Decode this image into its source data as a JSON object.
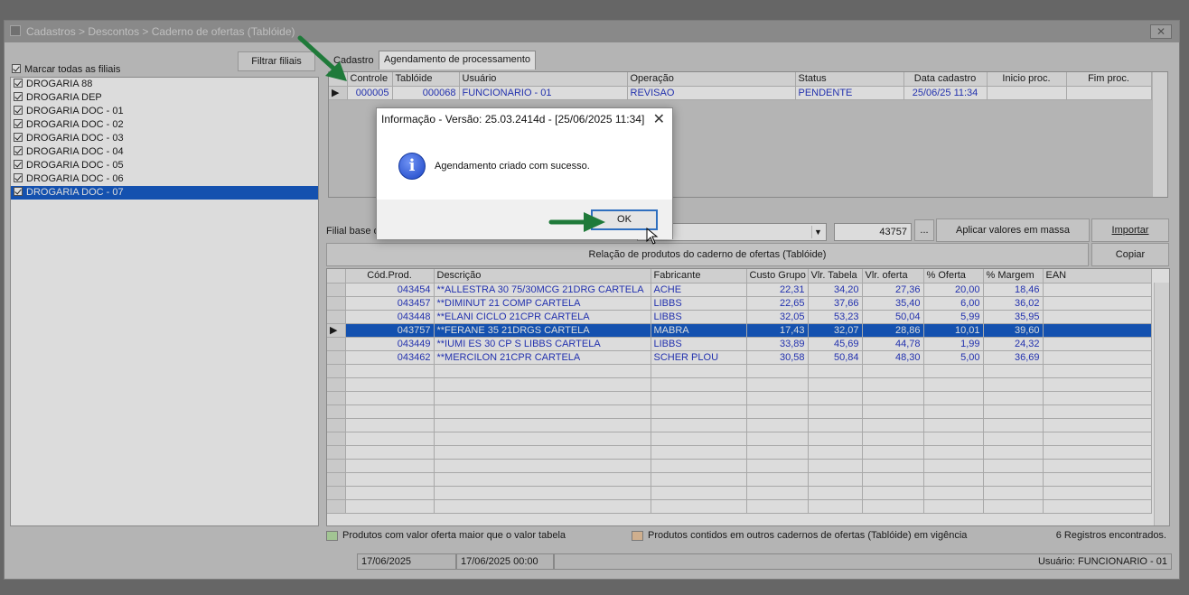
{
  "window": {
    "title": "Cadastros > Descontos > Caderno de ofertas (Tablóide)",
    "close_glyph": "✕"
  },
  "left_panel": {
    "filter_button": "Filtrar filiais",
    "select_all_label": "Marcar todas as filiais",
    "branches": [
      "DROGARIA 88",
      "DROGARIA DEP",
      "DROGARIA DOC - 01",
      "DROGARIA DOC - 02",
      "DROGARIA DOC - 03",
      "DROGARIA DOC - 04",
      "DROGARIA DOC - 05",
      "DROGARIA DOC - 06",
      "DROGARIA DOC - 07"
    ]
  },
  "tabs": {
    "tab1": "Cadastro",
    "tab2": "Agendamento de processamento"
  },
  "schedule_grid": {
    "headers": {
      "controle": "Controle",
      "tabloide": "Tablóide",
      "usuario": "Usuário",
      "operacao": "Operação",
      "status": "Status",
      "data_cadastro": "Data cadastro",
      "inicio": "Inicio proc.",
      "fim": "Fim proc."
    },
    "row": {
      "controle": "000005",
      "tabloide": "000068",
      "usuario": "FUNCIONARIO - 01",
      "operacao": "REVISAO",
      "status": "PENDENTE",
      "data_cadastro": "25/06/25 11:34",
      "inicio": "",
      "fim": ""
    }
  },
  "filial_label": "Filial base de",
  "product_code_value": "43757",
  "ellipsis_button": "...",
  "mass_button": "Aplicar valores em massa",
  "import_button": "Importar",
  "products_title": "Relação de produtos do caderno de ofertas (Tablóide)",
  "copy_button": "Copiar",
  "products_grid": {
    "headers": {
      "cod": "Cód.Prod.",
      "desc": "Descrição",
      "fab": "Fabricante",
      "custo": "Custo Grupo",
      "vtab": "Vlr. Tabela",
      "voferta": "Vlr. oferta",
      "pof": "% Oferta",
      "pmar": "% Margem",
      "ean": "EAN"
    },
    "rows": [
      {
        "cod": "043454",
        "desc": "**ALLESTRA 30 75/30MCG 21DRG CARTELA",
        "fab": "ACHE",
        "custo": "22,31",
        "vtab": "34,20",
        "voferta": "27,36",
        "pof": "20,00",
        "pmar": "18,46",
        "ean": ""
      },
      {
        "cod": "043457",
        "desc": "**DIMINUT 21 COMP CARTELA",
        "fab": "LIBBS",
        "custo": "22,65",
        "vtab": "37,66",
        "voferta": "35,40",
        "pof": "6,00",
        "pmar": "36,02",
        "ean": ""
      },
      {
        "cod": "043448",
        "desc": "**ELANI CICLO 21CPR CARTELA",
        "fab": "LIBBS",
        "custo": "32,05",
        "vtab": "53,23",
        "voferta": "50,04",
        "pof": "5,99",
        "pmar": "35,95",
        "ean": ""
      },
      {
        "cod": "043757",
        "desc": "**FERANE 35 21DRGS CARTELA",
        "fab": "MABRA",
        "custo": "17,43",
        "vtab": "32,07",
        "voferta": "28,86",
        "pof": "10,01",
        "pmar": "39,60",
        "ean": ""
      },
      {
        "cod": "043449",
        "desc": "**IUMI ES 30 CP S LIBBS CARTELA",
        "fab": "LIBBS",
        "custo": "33,89",
        "vtab": "45,69",
        "voferta": "44,78",
        "pof": "1,99",
        "pmar": "24,32",
        "ean": ""
      },
      {
        "cod": "043462",
        "desc": "**MERCILON 21CPR CARTELA",
        "fab": "SCHER PLOU",
        "custo": "30,58",
        "vtab": "50,84",
        "voferta": "48,30",
        "pof": "5,00",
        "pmar": "36,69",
        "ean": ""
      }
    ]
  },
  "legend": {
    "green": "Produtos com valor oferta maior que o valor tabela",
    "orange": "Produtos contidos em outros cadernos de ofertas (Tablóide) em vigência",
    "count": "6 Registros encontrados."
  },
  "status_bar": {
    "date1": "17/06/2025",
    "date2": "17/06/2025 00:00",
    "user": "Usuário: FUNCIONARIO - 01"
  },
  "dialog": {
    "title": "Informação - Versão: 25.03.2414d - [25/06/2025 11:34]",
    "message": "Agendamento criado com sucesso.",
    "ok": "OK",
    "close_glyph": "✕",
    "info_glyph": "i"
  },
  "colors": {
    "selection": "#0b56c8",
    "grid_text": "#1d2fc7",
    "arrow": "#1f7a3a",
    "legend_green": "#b9e3a7",
    "legend_orange": "#efc9a0"
  }
}
